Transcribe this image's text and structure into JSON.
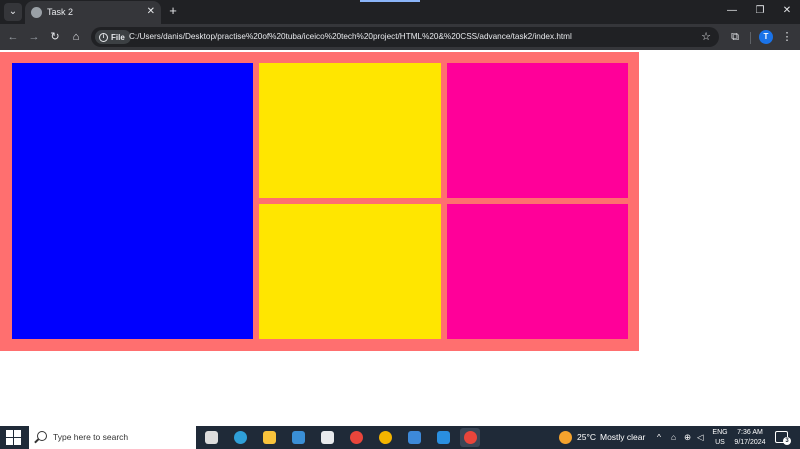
{
  "browser": {
    "tab": {
      "title": "Task 2",
      "close": "✕"
    },
    "tab_menu": "⌄",
    "new_tab": "+",
    "window_controls": {
      "minimize": "—",
      "restore": "❐",
      "close": "✕"
    },
    "nav": {
      "back": "←",
      "forward": "→",
      "reload": "↻",
      "home": "⌂"
    },
    "site_chip": {
      "info": "i",
      "label": "File"
    },
    "url": "C:/Users/danis/Desktop/practise%20of%20tuba/iceico%20tech%20project/HTML%20&%20CSS/advance/task2/index.html",
    "star": "☆",
    "extensions": "⧉",
    "profile_initial": "T",
    "menu": "⋮"
  },
  "page": {
    "colors": {
      "container": "#ff6f6f",
      "blue": "#0000ff",
      "yellow": "#ffe600",
      "pink": "#ff0099"
    }
  },
  "taskbar": {
    "search_placeholder": "Type here to search",
    "weather": {
      "temp": "25°C",
      "condition": "Mostly clear"
    },
    "tray_up": "^",
    "language": {
      "line1": "ENG",
      "line2": "US"
    },
    "time": "7:36 AM",
    "date": "9/17/2024",
    "notification_count": "3",
    "apps": [
      {
        "name": "task-view",
        "color": "#dddddd"
      },
      {
        "name": "edge",
        "color": "#2f9fd8"
      },
      {
        "name": "file-explorer",
        "color": "#f8c33c"
      },
      {
        "name": "microsoft-store",
        "color": "#3a8fd6"
      },
      {
        "name": "mail",
        "color": "#e8eaed"
      },
      {
        "name": "chrome",
        "color": "#e9453b"
      },
      {
        "name": "chrome-alt",
        "color": "#f4b400"
      },
      {
        "name": "photos",
        "color": "#3d89d9"
      },
      {
        "name": "vscode",
        "color": "#2a8fe0"
      },
      {
        "name": "chrome-profile",
        "color": "#e9453b"
      }
    ]
  }
}
